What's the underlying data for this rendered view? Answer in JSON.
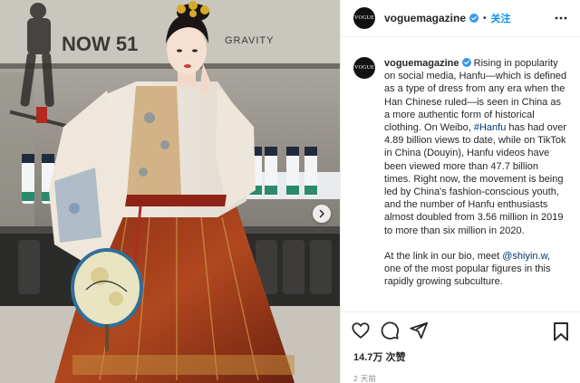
{
  "photo": {
    "alt_signs": [
      "NOW 51",
      "GRAVITY"
    ],
    "carousel_next_icon": "chevron-right-icon"
  },
  "header": {
    "avatar_text": "VOGUE",
    "username": "voguemagazine",
    "separator": "•",
    "follow_label": "关注",
    "more_icon": "more-horizontal-icon"
  },
  "caption": {
    "avatar_text": "VOGUE",
    "username": "voguemagazine",
    "part1": " Rising in popularity on social media, Hanfu—which is defined as a type of dress from any era when the Han Chinese ruled—is seen in China as a more authentic form of historical clothing. On Weibo, ",
    "hashtag": "#Hanfu",
    "part2": " has had over 4.89 billion views to date, while on TikTok in China (Douyin), Hanfu videos have been viewed more than 47.7 billion times. Right now, the movement is being led by China's fashion-conscious youth, and the number of Hanfu enthusiasts almost doubled from 3.56 million in 2019 to more than six million in 2020.",
    "p2_part1": "At the link in our bio, meet ",
    "mention": "@shiyin.w",
    "p2_part2": ", one of the most popular figures in this rapidly growing subculture."
  },
  "actions": {
    "like_icon": "heart-icon",
    "comment_icon": "comment-icon",
    "share_icon": "send-icon",
    "save_icon": "bookmark-icon",
    "likes": "14.7万 次赞",
    "time": "2 天前"
  },
  "colors": {
    "link": "#0095f6",
    "hashtag": "#00376b",
    "verified": "#3897f0",
    "muted": "#8e8e8e"
  }
}
